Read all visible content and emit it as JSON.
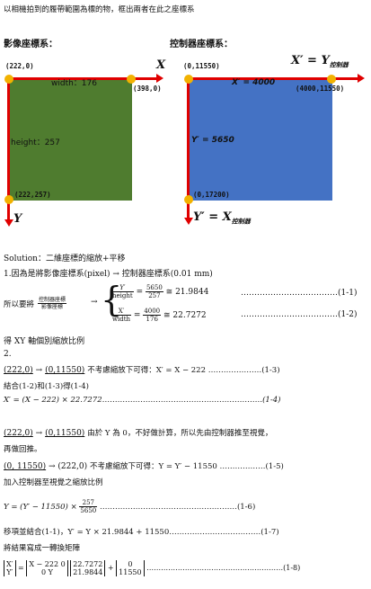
{
  "top_caption": "以相機拍到的履帶範圍為標的物，框出兩者在此之座標系",
  "left_diagram": {
    "title": "影像座標系：",
    "origin": "(222,0)",
    "top_right": "(398,0)",
    "bottom_left": "(222,257)",
    "x_axis": "X",
    "y_axis": "Y",
    "width_label": "width：176",
    "height_label": "height：257",
    "fill": "#4f7c2f"
  },
  "right_diagram": {
    "title": "控制器座標系：",
    "origin": "(0,11550)",
    "top_right": "(4000,11550)",
    "bottom_left": "(0,17200)",
    "x_axis_main": "X′ = Y",
    "x_axis_sub": "控制器",
    "y_axis_main": "Y′ = X",
    "y_axis_sub": "控制器",
    "width_label": "X′ = 4000",
    "height_label": "Y′ = 5650",
    "fill": "#4472c4"
  },
  "axis_color": "#e00000",
  "dot_color": "#f2b200",
  "body": {
    "solution": "Solution：二維座標的縮放+平移",
    "step1": "1.因為是將影像座標系(pixel) →  控制器座標系(0.01 mm)",
    "want_prefix": "所以要將",
    "want_num": "控制器座標",
    "want_den": "影像座標",
    "eq1_lhs_num": "Y′",
    "eq1_lhs_den": "height",
    "eq1_rhs_num": "5650",
    "eq1_rhs_den": "257",
    "eq1_value": "≅ 21.9844",
    "eq1_tag": "………………………………(1-1)",
    "eq2_lhs_num": "X′",
    "eq2_lhs_den": "width",
    "eq2_rhs_num": "4000",
    "eq2_rhs_den": "176",
    "eq2_value": "≅ 22.7272",
    "eq2_tag": "………………………………(1-2)",
    "scale_text": "得 XY 軸個別縮放比例",
    "step2": "2.",
    "line_1_3_a": "(222,0)",
    "line_1_3_b": "(0,11550)",
    "line_1_3_text": "不考慮縮放下可得：X′ = X − 222  …………………(1-3)",
    "combine_1": "結合(1-2)和(1-3)得(1-4)",
    "eq_1_4": "X′ = (X − 222) × 22.7272………………………………………………………(1-4)",
    "line_p2_a": "(222,0)",
    "line_p2_b": "(0,11550)",
    "line_p2_text": "由於 Y 為 0，不好做計算，所以先由控制器推至視覺，",
    "line_p2_cont": "再做回推。",
    "line_1_5_a": "(0, 11550)",
    "line_1_5_b": "(222,0)",
    "line_1_5_text": "不考慮縮放下可得：Y = Y′ − 11550  ………………(1-5)",
    "add_scale": "加入控制器至視覺之縮放比例",
    "eq_1_6_pre": "Y = (Y′ − 11550) ×",
    "eq_1_6_num": "257",
    "eq_1_6_den": "5650",
    "eq_1_6_tag": "………………………………………………(1-6)",
    "combine_2": "移項並結合(1-1)，Y′ = Y × 21.9844 + 11550………………………………(1-7)",
    "matrix_title": "將結果寫成一轉換矩陣",
    "mat_lhs_top": "X′",
    "mat_lhs_bot": "Y′",
    "mat_a_top": "X − 222    0",
    "mat_a_bot": "0        Y",
    "mat_b_top": "22.7272",
    "mat_b_bot": "21.9844",
    "mat_c_top": "0",
    "mat_c_bot": "11550",
    "mat_tag": "…………………………………………………(1-8)"
  }
}
